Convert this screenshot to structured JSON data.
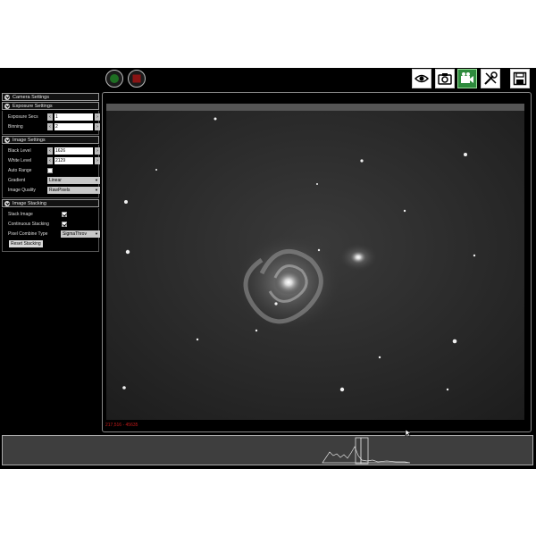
{
  "toolbar": {
    "play": "play-button",
    "stop": "stop-button",
    "icons": [
      "eye-icon",
      "camera-icon",
      "video-camera-icon",
      "tools-icon",
      "save-icon"
    ],
    "active_icon": "video-camera-icon",
    "accent_color": "#2e8b3d"
  },
  "panel": {
    "camera_settings": {
      "title": "Camera Settings"
    },
    "exposure_settings": {
      "title": "Exposure Settings",
      "exposure_label": "Exposure Secs",
      "exposure_value": "1",
      "binning_label": "Binning",
      "binning_value": "2"
    },
    "image_settings": {
      "title": "Image Settings",
      "black_label": "Black Level",
      "black_value": "1626",
      "white_label": "White Level",
      "white_value": "2129",
      "auto_range_label": "Auto Range",
      "auto_range_checked": false,
      "gradient_label": "Gradient",
      "gradient_value": "Linear",
      "quality_label": "Image Quality",
      "quality_value": "RawPixels"
    },
    "image_stacking": {
      "title": "Image Stacking",
      "stack_label": "Stack Image",
      "stack_checked": true,
      "continuous_label": "Continuous Stacking",
      "continuous_checked": true,
      "combine_label": "Pixel Combine Type",
      "combine_value": "SigmaThrov",
      "reset_label": "Reset Stacking"
    }
  },
  "viewer": {
    "coordinates": "217,516 - 45635"
  }
}
